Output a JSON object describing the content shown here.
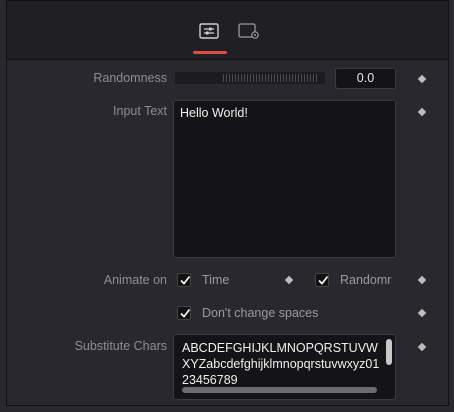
{
  "tabs": [
    {
      "name": "controls-tab-icon",
      "active": true
    },
    {
      "name": "settings-tab-icon",
      "active": false
    }
  ],
  "accent_color": "#e04b44",
  "randomness": {
    "label": "Randomness",
    "value": "0.0"
  },
  "input_text": {
    "label": "Input Text",
    "value": "Hello World!"
  },
  "animate_on": {
    "label": "Animate on",
    "time": {
      "label": "Time",
      "checked": true
    },
    "random": {
      "label": "Randomr",
      "checked": true
    }
  },
  "dont_change_spaces": {
    "label": "Don't change spaces",
    "checked": true
  },
  "substitute_chars": {
    "label": "Substitute Chars",
    "value": "ABCDEFGHIJKLMNOPQRSTUVWXYZabcdefghijklmnopqrstuvwxyz0123456789"
  }
}
